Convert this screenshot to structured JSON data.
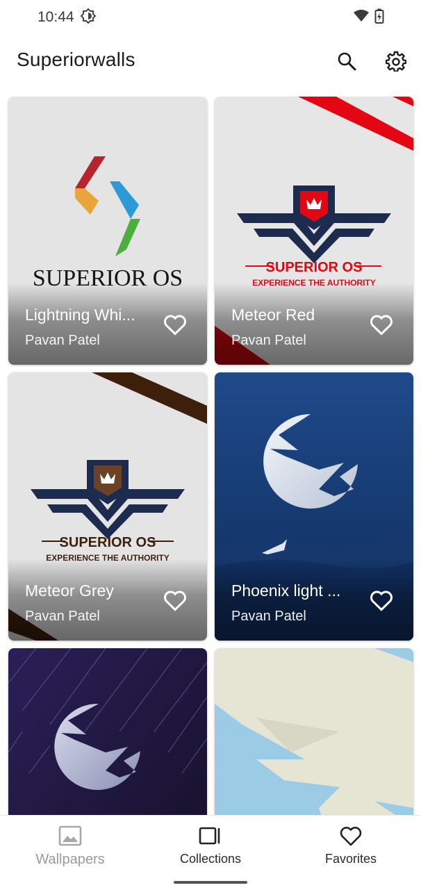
{
  "status_bar": {
    "time": "10:44"
  },
  "app_bar": {
    "title": "Superiorwalls"
  },
  "wallpapers": [
    {
      "title": "Lightning Whi...",
      "author": "Pavan Patel",
      "logo_text": "SUPERIOR OS"
    },
    {
      "title": "Meteor Red",
      "author": "Pavan Patel",
      "logo_text": "SUPERIOR OS",
      "tagline": "EXPERIENCE THE AUTHORITY"
    },
    {
      "title": "Meteor Grey",
      "author": "Pavan Patel",
      "logo_text": "SUPERIOR OS",
      "tagline": "EXPERIENCE THE AUTHORITY"
    },
    {
      "title": "Phoenix light ...",
      "author": "Pavan Patel"
    }
  ],
  "bottom_nav": {
    "items": [
      {
        "label": "Wallpapers",
        "icon": "image-icon",
        "state": "inactive"
      },
      {
        "label": "Collections",
        "icon": "collections-icon",
        "state": "active"
      },
      {
        "label": "Favorites",
        "icon": "heart-icon",
        "state": "active"
      }
    ]
  },
  "colors": {
    "accent_red": "#e30613",
    "navy": "#1d2b4f",
    "brown": "#3d1f0c",
    "phoenix_blue": "#1f4a8a"
  }
}
